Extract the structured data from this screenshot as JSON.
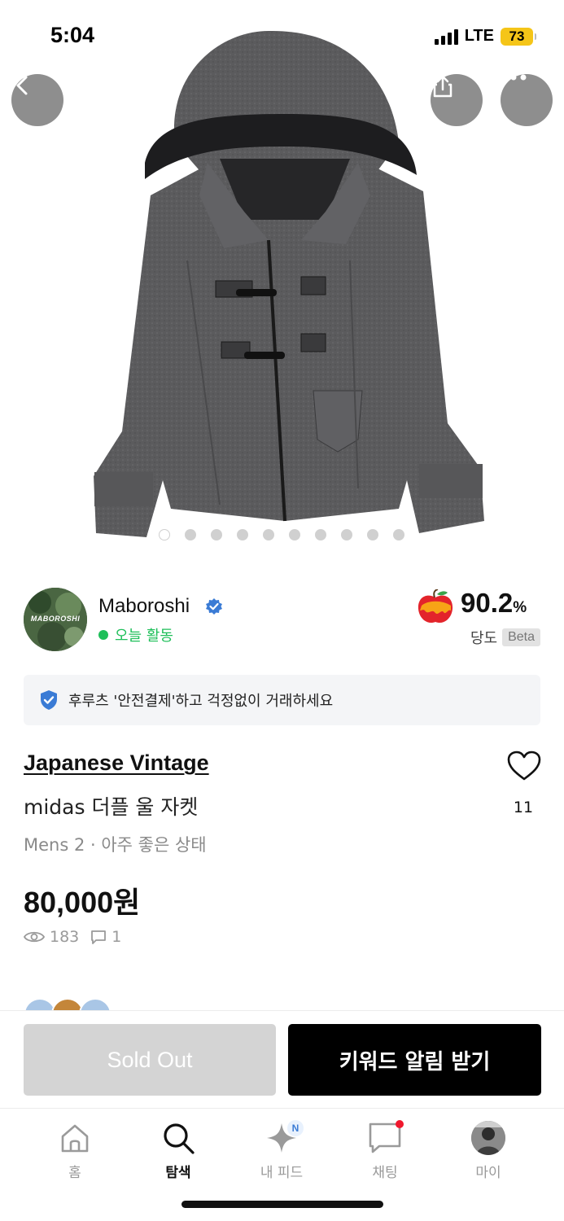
{
  "status_bar": {
    "time": "5:04",
    "network": "LTE",
    "battery": "73"
  },
  "hero": {
    "icons": [
      "back-arrow-icon",
      "share-icon",
      "more-icon"
    ],
    "image_index": 1,
    "image_count": 10
  },
  "seller": {
    "name": "Maboroshi",
    "avatar_text": "MABOROSHI",
    "activity": "오늘 활동",
    "score": "90.2",
    "score_unit": "%",
    "score_label": "당도",
    "beta": "Beta"
  },
  "safe_banner": {
    "text": "후루츠 '안전결제'하고 걱정없이 거래하세요"
  },
  "product": {
    "brand": "Japanese Vintage",
    "title": "midas 더플 울 자켓",
    "meta": "Mens 2 · 아주 좋은 상태",
    "price": "80,000원",
    "views": "183",
    "comments": "1",
    "likes": "11"
  },
  "actions": {
    "sold_out": "Sold Out",
    "keyword_alert": "키워드 알림 받기"
  },
  "tabbar": {
    "items": [
      {
        "label": "홈",
        "icon": "home-icon"
      },
      {
        "label": "탐색",
        "icon": "search-icon",
        "active": true
      },
      {
        "label": "내 피드",
        "icon": "sparkle-icon",
        "badge": "N"
      },
      {
        "label": "채팅",
        "icon": "chat-icon"
      },
      {
        "label": "마이",
        "icon": "profile-icon"
      }
    ]
  },
  "colors": {
    "accent_green": "#1fbf5a",
    "verified_blue": "#3a7bd5",
    "battery": "#f5c518",
    "primary_button": "#000000",
    "disabled_button": "#d4d4d4"
  }
}
